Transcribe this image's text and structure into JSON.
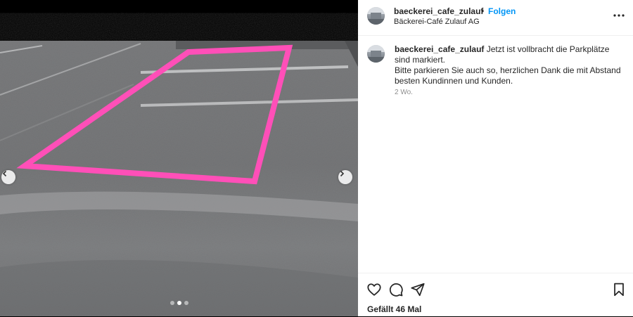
{
  "post": {
    "username": "baeckerei_cafe_zulauf",
    "separator": "•",
    "follow_label": "Folgen",
    "location": "Bäckerei-Café Zulauf AG",
    "caption_line1": " Jetzt ist vollbracht die Parkplätze sind markiert.",
    "caption_line2": "Bitte parkieren Sie auch so, herzlichen Dank die mit Abstand besten Kundinnen und Kunden.",
    "time_ago": "2 Wo.",
    "likes": "Gefällt 46 Mal"
  },
  "carousel": {
    "current_index": 2,
    "total": 3
  },
  "icons": {
    "more": "more-horizontal-icon",
    "like": "heart-icon",
    "comment": "comment-icon",
    "share": "send-icon",
    "save": "bookmark-icon",
    "prev": "chevron-left-icon",
    "next": "chevron-right-icon"
  },
  "colors": {
    "accent": "#0095f6",
    "marking": "#ff4fb8",
    "text": "#262626",
    "muted": "#8e8e8e"
  }
}
